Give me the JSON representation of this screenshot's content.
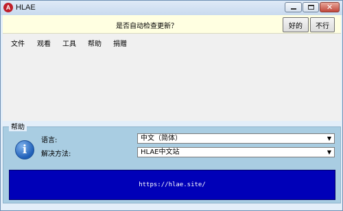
{
  "window": {
    "title": "HLAE",
    "app_icon": "hlae-logo-icon",
    "controls": [
      "minimize-icon",
      "maximize-icon",
      "close-icon"
    ]
  },
  "notification": {
    "text": "是否自动检查更新？",
    "ok_label": "好的",
    "no_label": "不行",
    "background": "#ffffe1"
  },
  "menu": {
    "items": [
      "文件",
      "观看",
      "工具",
      "帮助",
      "捐赠"
    ]
  },
  "help": {
    "title": "帮助",
    "icon": "info-icon",
    "language_label": "语言:",
    "language_value": "中文（简体）",
    "solution_label": "解决方法:",
    "solution_value": "HLAE中文站",
    "link": "https://hlae.site/",
    "link_background": "#0000b8"
  }
}
